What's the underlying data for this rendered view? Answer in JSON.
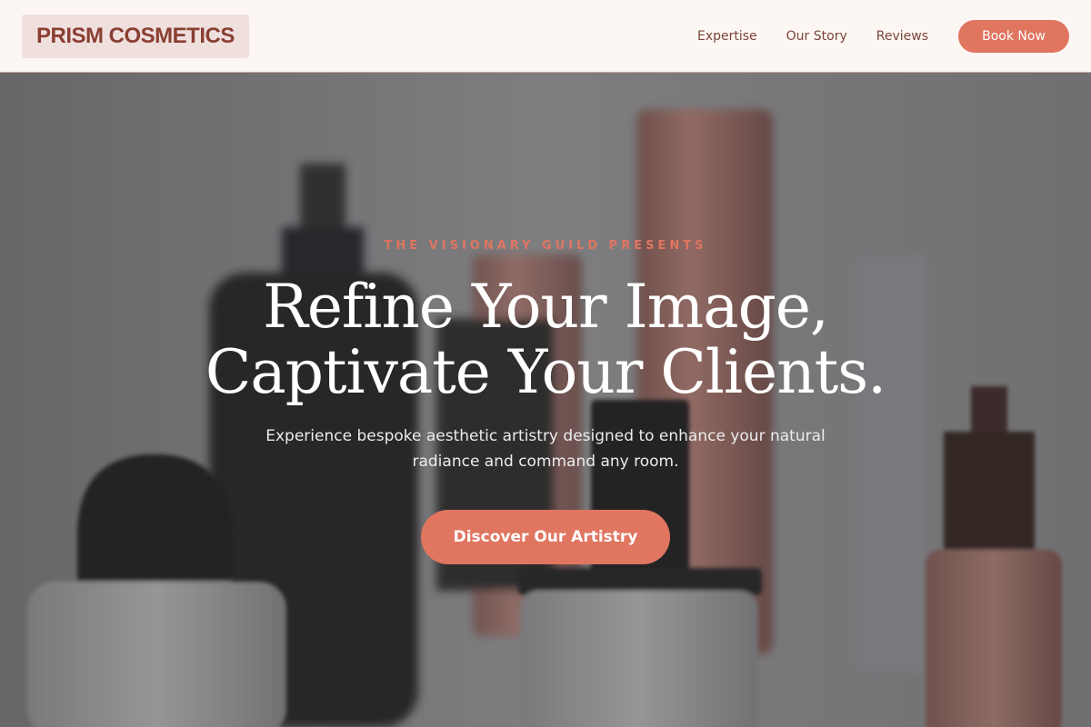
{
  "brand": {
    "logo_text": "PRISM COSMETICS"
  },
  "nav": {
    "links": [
      "Expertise",
      "Our Story",
      "Reviews"
    ],
    "cta_label": "Book Now"
  },
  "hero": {
    "eyebrow": "THE VISIONARY GUILD PRESENTS",
    "headline_line1": "Refine Your Image,",
    "headline_line2": "Captivate Your Clients.",
    "subheadline": "Experience bespoke aesthetic artistry designed to enhance your natural radiance and command any room.",
    "cta_label": "Discover Our Artistry",
    "background_image": "cosmetic-bottles-photo"
  },
  "colors": {
    "accent": "#e07560",
    "header_bg": "#fdf7f4",
    "logo_bg": "#efe0de",
    "logo_text": "#8a3e32",
    "nav_text": "#7a4438"
  }
}
